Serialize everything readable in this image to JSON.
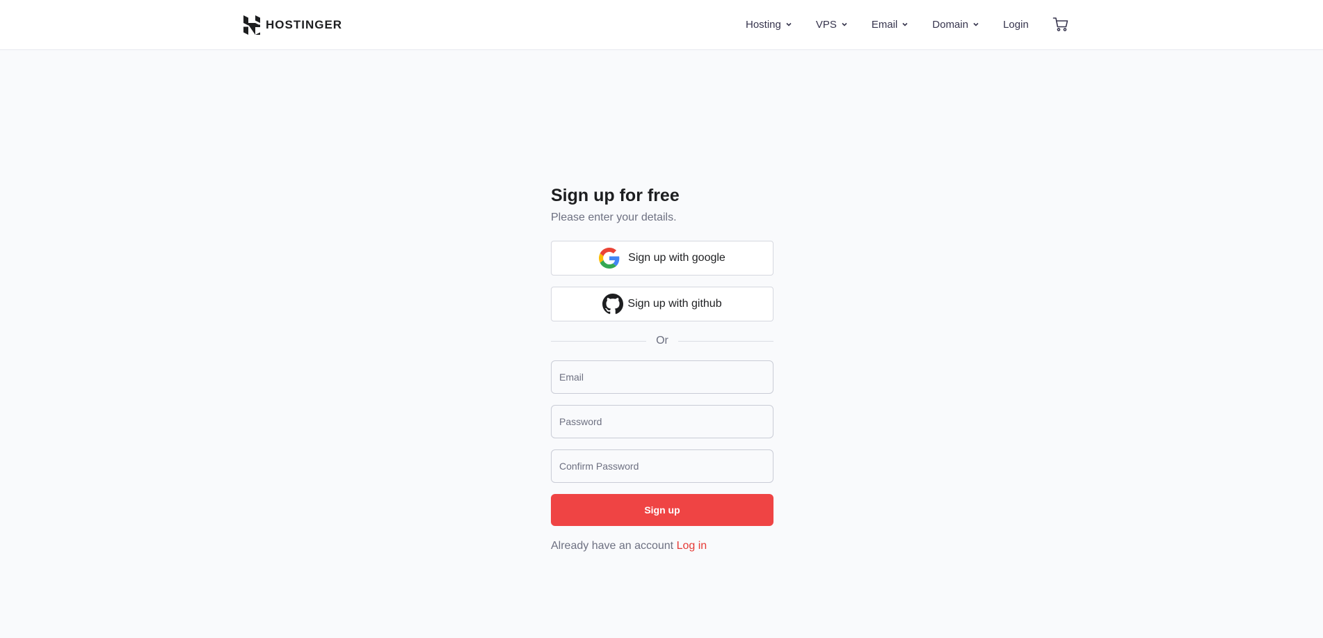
{
  "header": {
    "brand": "HOSTINGER",
    "nav": [
      {
        "label": "Hosting",
        "has_dropdown": true
      },
      {
        "label": "VPS",
        "has_dropdown": true
      },
      {
        "label": "Email",
        "has_dropdown": true
      },
      {
        "label": "Domain",
        "has_dropdown": true
      }
    ],
    "login_label": "Login",
    "cart_icon": "cart-icon"
  },
  "form": {
    "title": "Sign up for free",
    "subtitle": "Please enter your details.",
    "google_label": "Sign up with google",
    "github_label": "Sign up with github",
    "divider_label": "Or",
    "email_placeholder": "Email",
    "password_placeholder": "Password",
    "confirm_placeholder": "Confirm Password",
    "submit_label": "Sign up",
    "footer_text": "Already have an account",
    "footer_link": "Log in"
  },
  "colors": {
    "accent": "#ef4444",
    "link": "#e53935",
    "background": "#f9fafc"
  }
}
